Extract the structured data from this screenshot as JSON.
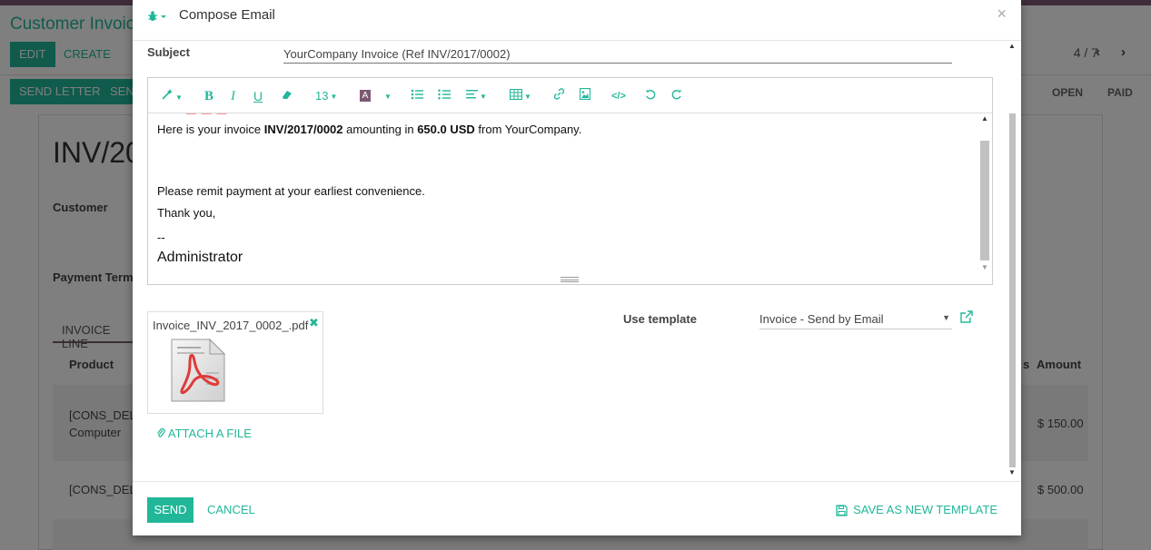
{
  "background": {
    "title": "Customer Invoice",
    "edit_label": "EDIT",
    "create_label": "CREATE",
    "send_letter_label": "SEND LETTER",
    "send_partial": "SEN",
    "pager": "4 / 7",
    "status_open": "OPEN",
    "status_paid": "PAID",
    "invoice_partial": "INV/20",
    "customer_label": "Customer",
    "payment_terms_label": "Payment Terms",
    "invoice_lines_tab": "INVOICE LINE",
    "col_product": "Product",
    "col_taxes_partial": "s",
    "col_amount": "Amount",
    "row1_line1": "[CONS_DEL",
    "row1_line2": "Computer",
    "row1_amount": "$ 150.00",
    "row2_line1": "[CONS_DEL",
    "row2_amount": "$ 500.00"
  },
  "modal": {
    "title": "Compose Email",
    "close": "×",
    "subject_label": "Subject",
    "subject_value": "YourCompany Invoice (Ref INV/2017/0002)",
    "toolbar": {
      "font_size": "13",
      "font_color_glyph": "A"
    },
    "body": {
      "line1_pre": "Here is your invoice ",
      "line1_ref": "INV/2017/0002",
      "line1_mid": " amounting in ",
      "line1_amount": "650.0 USD",
      "line1_post": " from YourCompany.",
      "line2": "Please remit payment at your earliest convenience.",
      "line3": "Thank you,",
      "line4": "--",
      "signature": "Administrator"
    },
    "attachment": {
      "filename": "Invoice_INV_2017_0002_.pdf",
      "remove": "✖"
    },
    "attach_file_label": "ATTACH A FILE",
    "use_template_label": "Use template",
    "template_value": "Invoice - Send by Email",
    "send_label": "SEND",
    "cancel_label": "CANCEL",
    "save_template_label": "SAVE AS NEW TEMPLATE"
  },
  "colors": {
    "accent": "#21b799",
    "brand": "#7c5a73"
  }
}
